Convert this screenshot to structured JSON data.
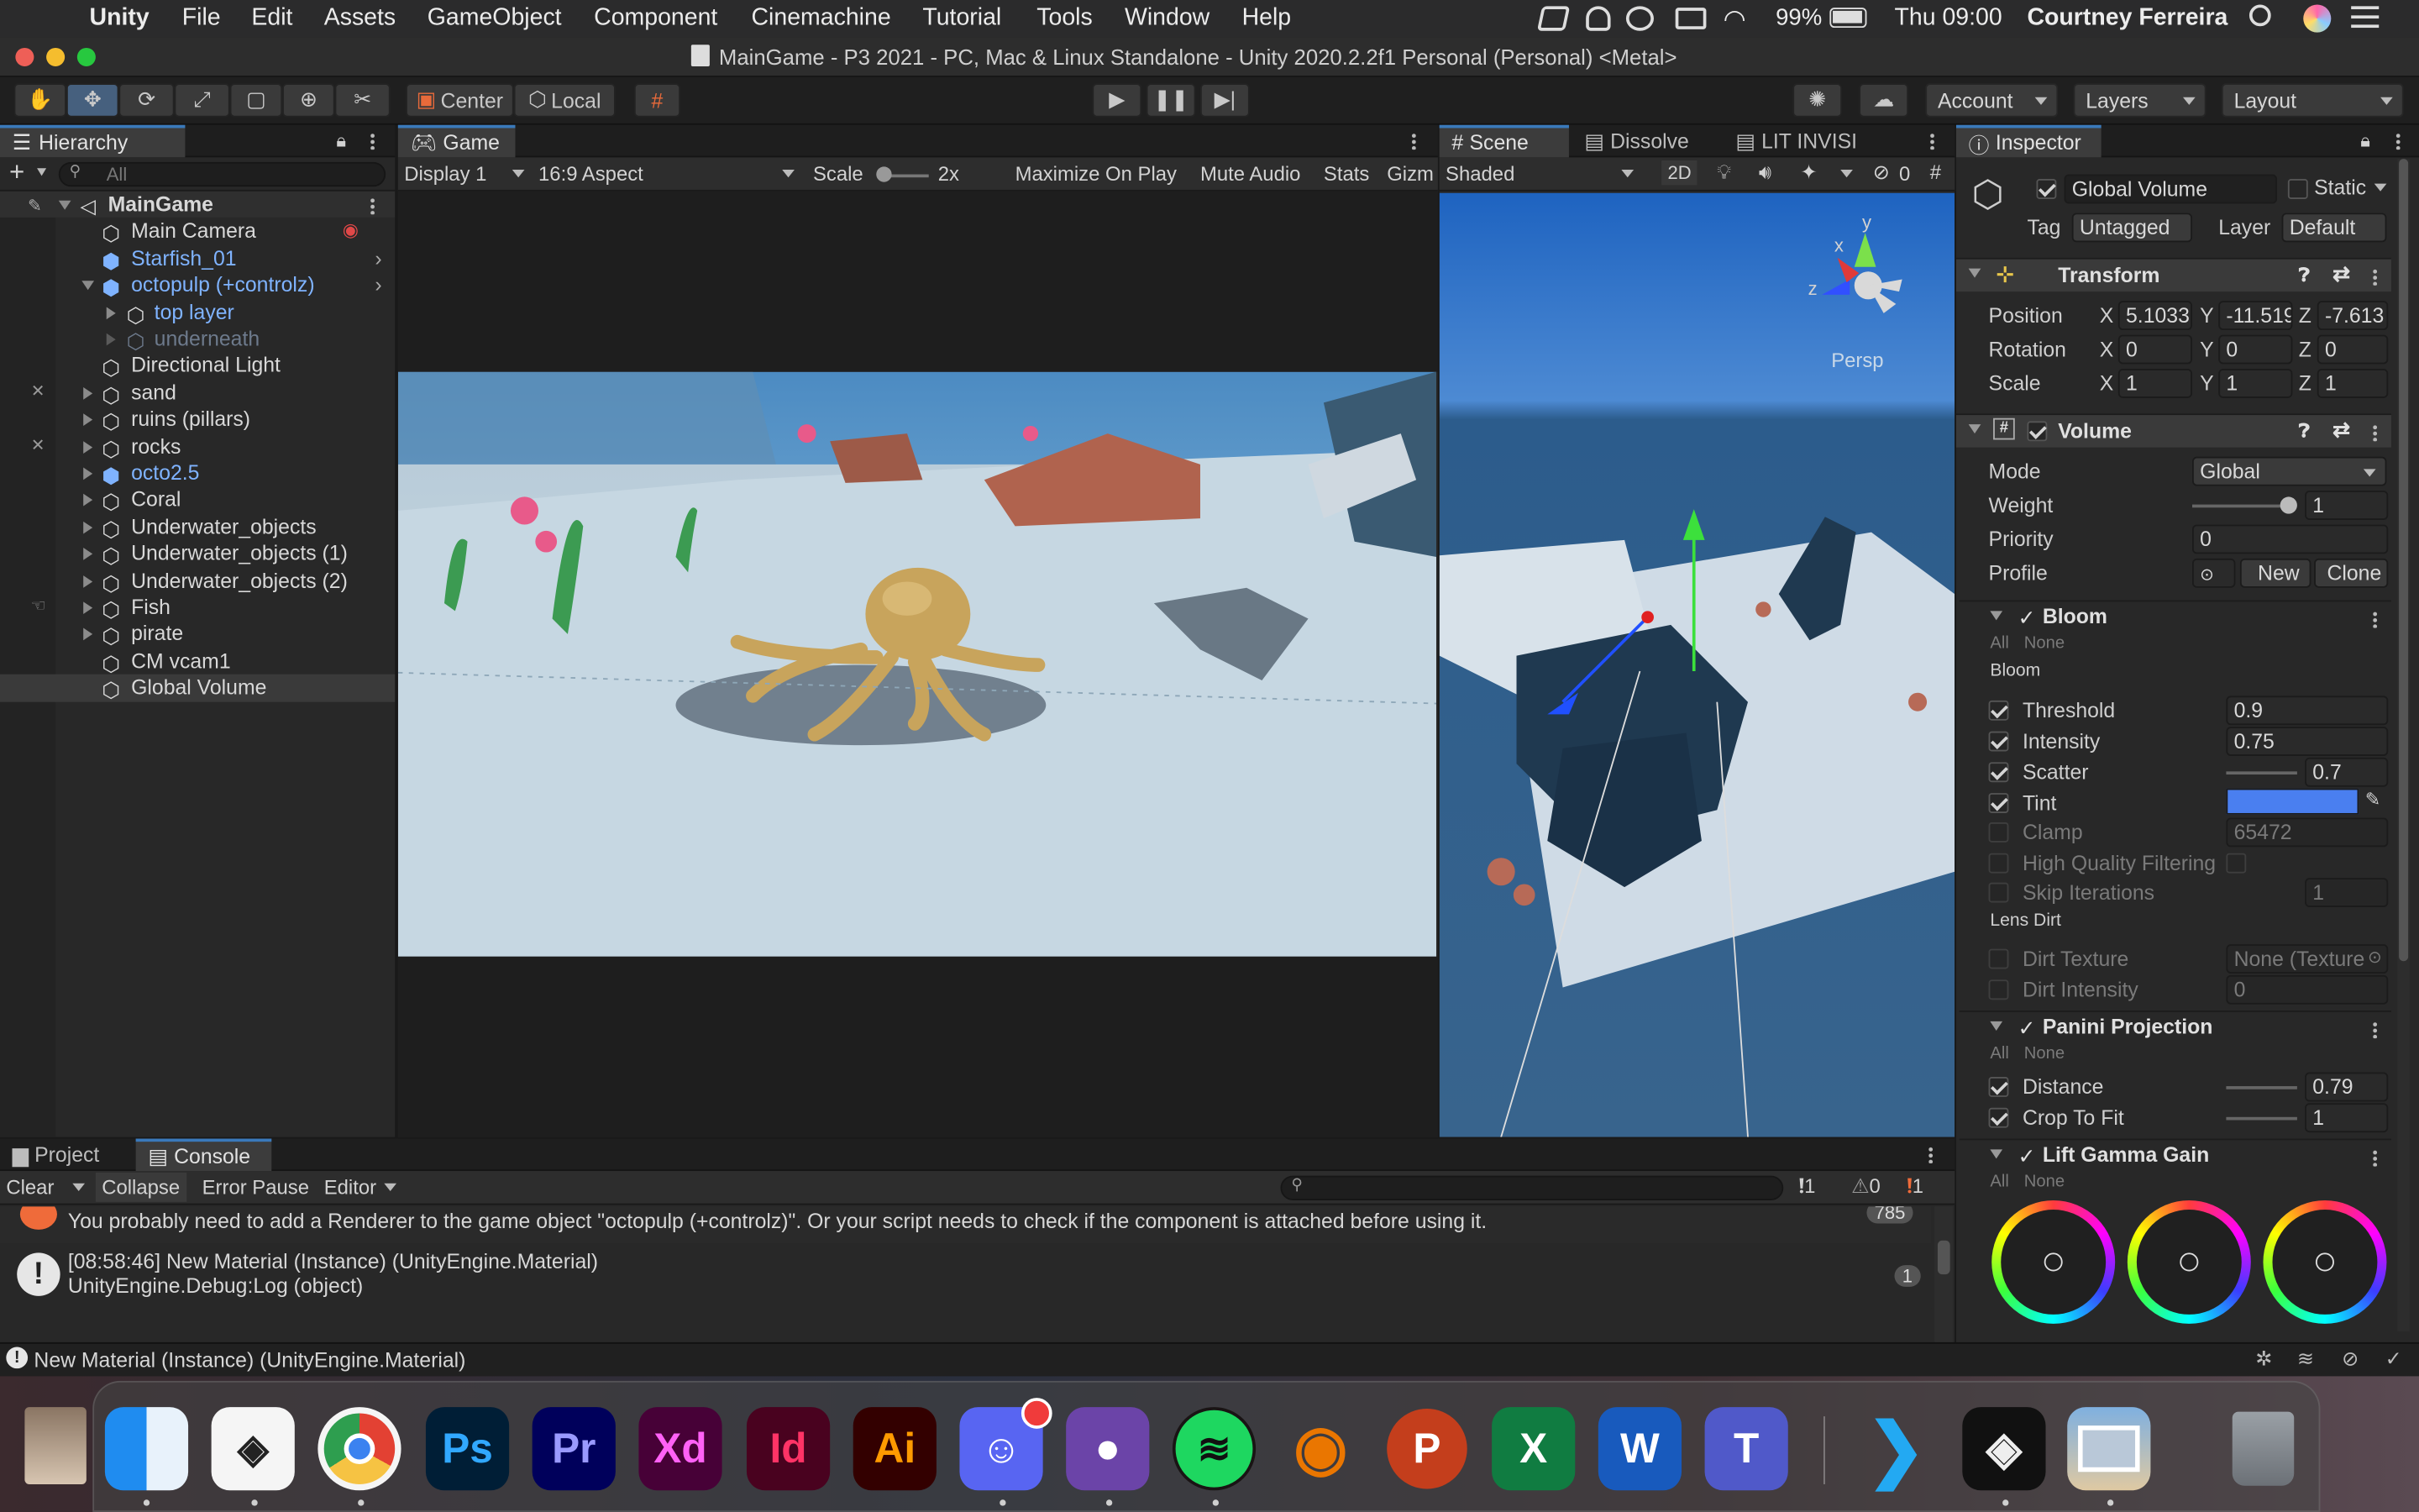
{
  "menubar": {
    "app_name": "Unity",
    "items": [
      "File",
      "Edit",
      "Assets",
      "GameObject",
      "Component",
      "Cinemachine",
      "Tutorial",
      "Tools",
      "Window",
      "Help"
    ],
    "battery": "99%",
    "clock": "Thu 09:00",
    "user": "Courtney Ferreira"
  },
  "window": {
    "title": "MainGame - P3 2021 - PC, Mac & Linux Standalone - Unity 2020.2.2f1 Personal (Personal) <Metal>"
  },
  "toolbar": {
    "pivot_label": "Center",
    "space_label": "Local",
    "account_label": "Account",
    "layers_label": "Layers",
    "layout_label": "Layout"
  },
  "hierarchy": {
    "tab_label": "Hierarchy",
    "search_placeholder": "All",
    "scene_name": "MainGame",
    "items": [
      {
        "label": "Main Camera"
      },
      {
        "label": "Starfish_01"
      },
      {
        "label": "octopulp (+controlz)"
      },
      {
        "label": "top layer"
      },
      {
        "label": "underneath"
      },
      {
        "label": "Directional Light"
      },
      {
        "label": "sand"
      },
      {
        "label": "ruins (pillars)"
      },
      {
        "label": "rocks"
      },
      {
        "label": "octo2.5"
      },
      {
        "label": "Coral"
      },
      {
        "label": "Underwater_objects"
      },
      {
        "label": "Underwater_objects (1)"
      },
      {
        "label": "Underwater_objects (2)"
      },
      {
        "label": "Fish"
      },
      {
        "label": "pirate"
      },
      {
        "label": "CM vcam1"
      },
      {
        "label": "Global Volume"
      }
    ]
  },
  "game": {
    "tab_label": "Game",
    "display": "Display 1",
    "aspect": "16:9 Aspect",
    "scale_label": "Scale",
    "scale_value": "2x",
    "maximize": "Maximize On Play",
    "mute": "Mute Audio",
    "stats": "Stats",
    "gizmos": "Gizm"
  },
  "scene": {
    "tabs": [
      "Scene",
      "Dissolve",
      "LIT INVISI"
    ],
    "shading": "Shaded",
    "mode_2d": "2D",
    "hidden_count": "0",
    "persp": "Persp",
    "axes": {
      "y": "y",
      "x": "x",
      "z": "z"
    }
  },
  "inspector": {
    "tab_label": "Inspector",
    "object_name": "Global Volume",
    "static_label": "Static",
    "tag_label": "Tag",
    "tag_value": "Untagged",
    "layer_label": "Layer",
    "layer_value": "Default",
    "transform": {
      "title": "Transform",
      "position_label": "Position",
      "rotation_label": "Rotation",
      "scale_label": "Scale",
      "position": {
        "x": "5.1033",
        "y": "-11.519",
        "z": "-7.613"
      },
      "rotation": {
        "x": "0",
        "y": "0",
        "z": "0"
      },
      "scale": {
        "x": "1",
        "y": "1",
        "z": "1"
      },
      "axis_x": "X",
      "axis_y": "Y",
      "axis_z": "Z"
    },
    "volume": {
      "title": "Volume",
      "mode_label": "Mode",
      "mode_value": "Global",
      "weight_label": "Weight",
      "weight_value": "1",
      "priority_label": "Priority",
      "priority_value": "0",
      "profile_label": "Profile",
      "new_button": "New",
      "clone_button": "Clone"
    },
    "bloom": {
      "title": "Bloom",
      "all": "All",
      "none": "None",
      "group_label": "Bloom",
      "threshold_label": "Threshold",
      "threshold_value": "0.9",
      "intensity_label": "Intensity",
      "intensity_value": "0.75",
      "scatter_label": "Scatter",
      "scatter_value": "0.7",
      "tint_label": "Tint",
      "tint_color": "#4a7ff0",
      "clamp_label": "Clamp",
      "clamp_value": "65472",
      "hq_label": "High Quality Filtering",
      "skip_label": "Skip Iterations",
      "skip_value": "1",
      "lens_dirt_label": "Lens Dirt",
      "dirt_texture_label": "Dirt Texture",
      "dirt_texture_value": "None (Texture",
      "dirt_intensity_label": "Dirt Intensity",
      "dirt_intensity_value": "0"
    },
    "panini": {
      "title": "Panini Projection",
      "all": "All",
      "none": "None",
      "distance_label": "Distance",
      "distance_value": "0.79",
      "crop_label": "Crop To Fit",
      "crop_value": "1"
    },
    "lgg": {
      "title": "Lift Gamma Gain",
      "all": "All",
      "none": "None"
    }
  },
  "console": {
    "tabs": [
      "Project",
      "Console"
    ],
    "clear": "Clear",
    "collapse": "Collapse",
    "error_pause": "Error Pause",
    "editor": "Editor",
    "info_count": "1",
    "warn_count": "0",
    "error_count": "1",
    "msg1": "You probably need to add a Renderer to the game object \"octopulp (+controlz)\". Or your script needs to check if the component is attached before using it.",
    "msg1_count": "785",
    "msg2_line1": "[08:58:46] New Material (Instance) (UnityEngine.Material)",
    "msg2_line2": "UnityEngine.Debug:Log (object)",
    "msg2_count": "1"
  },
  "statusbar": {
    "text": "New Material (Instance) (UnityEngine.Material)"
  },
  "dock": {
    "apps": [
      {
        "name": "Finder",
        "label": ""
      },
      {
        "name": "Unity Hub",
        "label": ""
      },
      {
        "name": "Chrome",
        "label": ""
      },
      {
        "name": "Photoshop",
        "label": "Ps"
      },
      {
        "name": "Premiere",
        "label": "Pr"
      },
      {
        "name": "XD",
        "label": "Xd"
      },
      {
        "name": "InDesign",
        "label": "Id"
      },
      {
        "name": "Illustrator",
        "label": "Ai"
      },
      {
        "name": "Discord",
        "label": ""
      },
      {
        "name": "GitHub",
        "label": ""
      },
      {
        "name": "Spotify",
        "label": ""
      },
      {
        "name": "Blender",
        "label": ""
      },
      {
        "name": "PowerPoint",
        "label": "P"
      },
      {
        "name": "Excel",
        "label": "X"
      },
      {
        "name": "Word",
        "label": "W"
      },
      {
        "name": "Teams",
        "label": "T"
      },
      {
        "name": "VS Code",
        "label": ""
      },
      {
        "name": "Unity",
        "label": ""
      },
      {
        "name": "Preview",
        "label": ""
      },
      {
        "name": "Trash",
        "label": ""
      }
    ]
  }
}
